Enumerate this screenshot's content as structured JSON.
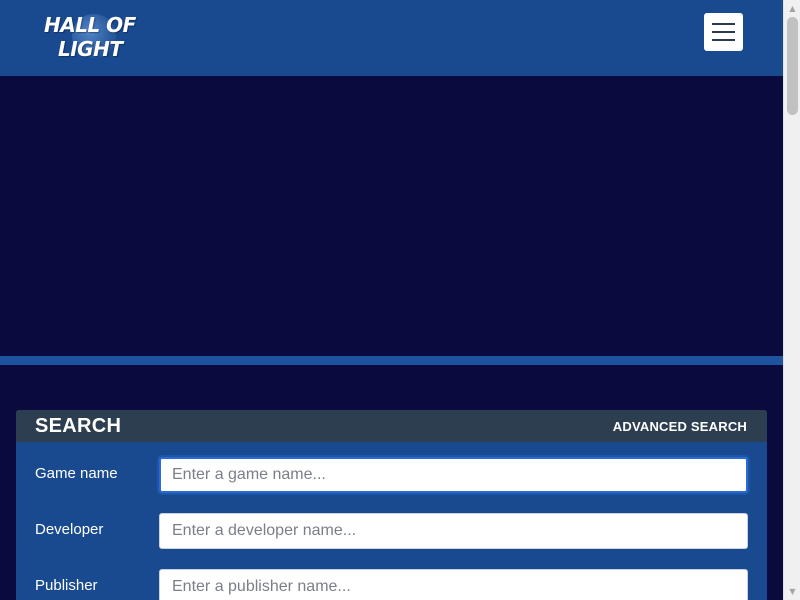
{
  "brand": {
    "logo_line1": "HALL OF",
    "logo_line2": "LIGHT"
  },
  "header": {
    "menu_icon": "hamburger-menu-icon"
  },
  "search": {
    "title": "SEARCH",
    "advanced_label": "ADVANCED SEARCH",
    "fields": [
      {
        "label": "Game name",
        "placeholder": "Enter a game name...",
        "value": ""
      },
      {
        "label": "Developer",
        "placeholder": "Enter a developer name...",
        "value": ""
      },
      {
        "label": "Publisher",
        "placeholder": "Enter a publisher name...",
        "value": ""
      }
    ]
  },
  "colors": {
    "header_bg": "#194a8f",
    "page_bg": "#0a0a3e",
    "stripe": "#1e53a0",
    "search_header_bg": "#2c3e50",
    "focus_ring": "#2a6ad4"
  },
  "scrollbar": {
    "up_icon": "scroll-up-arrow-icon",
    "down_icon": "scroll-down-arrow-icon"
  }
}
